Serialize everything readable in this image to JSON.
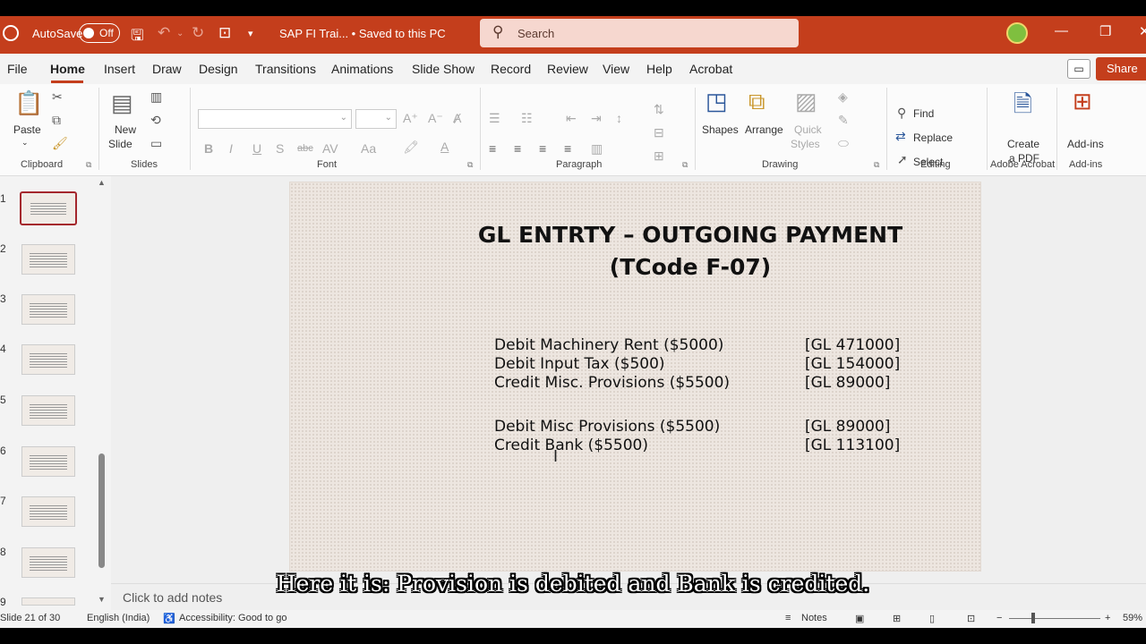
{
  "titlebar": {
    "autosave_label": "AutoSave",
    "autosave_state": "Off",
    "document_title": "SAP FI Trai...  •  Saved to this PC",
    "search_placeholder": "Search",
    "icons": [
      "powerpoint-logo-icon",
      "save-icon",
      "undo-icon",
      "redo-icon",
      "present-icon",
      "customize-icon",
      "search-icon",
      "minimize-icon",
      "restore-icon",
      "close-icon"
    ]
  },
  "menu": {
    "tabs": [
      "File",
      "Home",
      "Insert",
      "Draw",
      "Design",
      "Transitions",
      "Animations",
      "Slide Show",
      "Record",
      "Review",
      "View",
      "Help",
      "Acrobat"
    ],
    "active_tab": "Home",
    "share_label": "Share"
  },
  "ribbon": {
    "clipboard": {
      "label": "Clipboard",
      "paste": "Paste"
    },
    "slides": {
      "label": "Slides",
      "new_slide": "New",
      "new_slide_2": "Slide"
    },
    "font": {
      "label": "Font",
      "bold": "B",
      "italic": "I",
      "underline": "U",
      "shadow": "S",
      "strike": "abc",
      "spacing": "AV",
      "case": "Aa"
    },
    "paragraph": {
      "label": "Paragraph"
    },
    "drawing": {
      "label": "Drawing",
      "shapes": "Shapes",
      "arrange": "Arrange",
      "quick_styles": "Quick",
      "quick_styles_2": "Styles"
    },
    "editing": {
      "label": "Editing",
      "find": "Find",
      "replace": "Replace",
      "select": "Select"
    },
    "adobe": {
      "label": "Adobe Acrobat",
      "create_pdf": "Create",
      "create_pdf_2": "a PDF"
    },
    "addins": {
      "label": "Add-ins",
      "addins_btn": "Add-ins"
    }
  },
  "thumbnails": [
    "1",
    "2",
    "3",
    "4",
    "5",
    "6",
    "7",
    "8",
    "9"
  ],
  "slide": {
    "title_line1": "GL ENTRTY – OUTGOING PAYMENT",
    "title_line2": "(TCode F-07)",
    "entries": [
      {
        "desc": "Debit Machinery Rent ($5000)",
        "gl": "[GL 471000]"
      },
      {
        "desc": "Debit Input Tax ($500)",
        "gl": "[GL 154000]"
      },
      {
        "desc": "Credit Misc. Provisions ($5500)",
        "gl": "[GL 89000]"
      },
      {
        "desc": "Debit Misc Provisions ($5500)",
        "gl": "[GL 89000]"
      },
      {
        "desc": "Credit Bank ($5500)",
        "gl": "[GL 113100]"
      }
    ]
  },
  "notes_placeholder": "Click to add notes",
  "caption": "Here it is: Provision is debited and Bank is credited.",
  "status": {
    "slide_counter": "Slide 21 of 30",
    "language": "English (India)",
    "accessibility": "Accessibility: Good to go",
    "notes": "Notes",
    "zoom": "59%"
  },
  "colors": {
    "accent": "#c43e1c",
    "search_bg": "#f6d7cf",
    "slide_bg": "#ede6e0"
  }
}
